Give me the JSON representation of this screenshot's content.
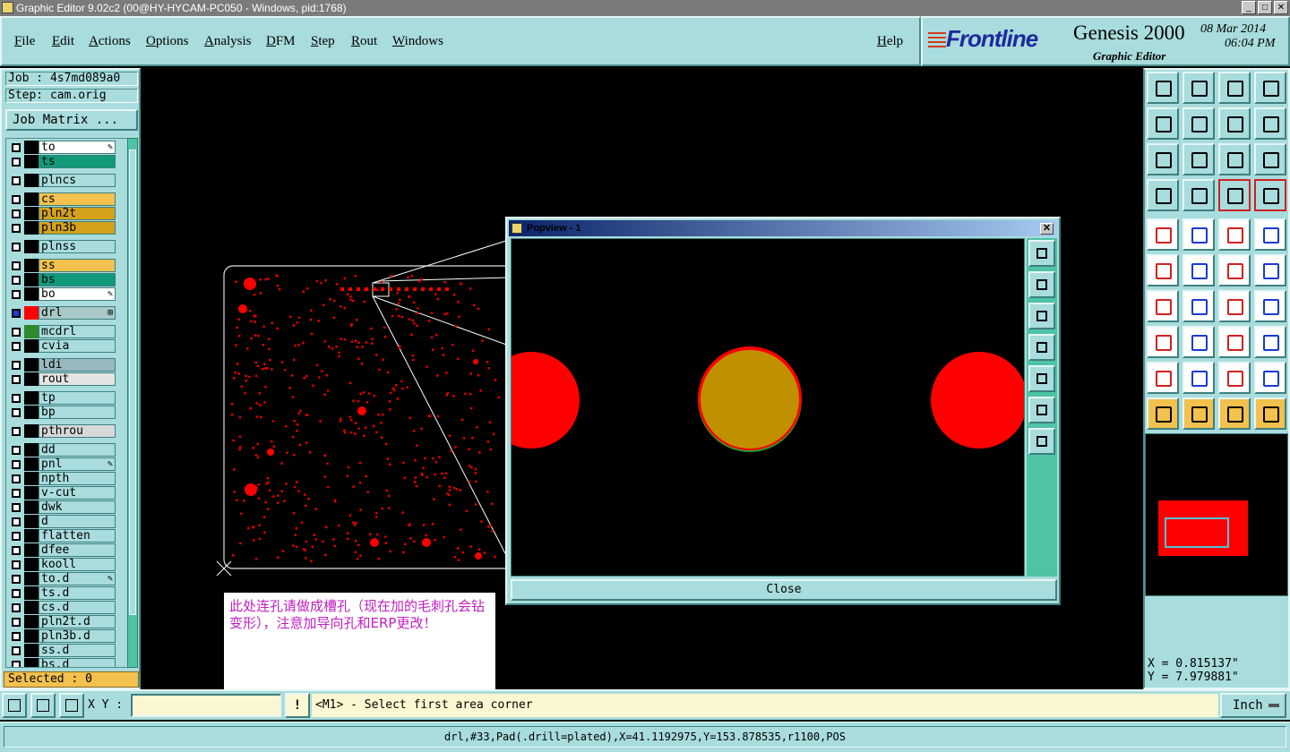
{
  "window": {
    "title": "Graphic Editor 9.02c2 (00@HY-HYCAM-PC050 - Windows, pid:1768)"
  },
  "menu": {
    "items": [
      "File",
      "Edit",
      "Actions",
      "Options",
      "Analysis",
      "DFM",
      "Step",
      "Rout",
      "Windows"
    ],
    "help": "Help"
  },
  "brand": {
    "logo": "Frontline",
    "product": "Genesis 2000",
    "subtitle": "Graphic Editor",
    "date": "08 Mar 2014",
    "time": "06:04 PM"
  },
  "job": {
    "job_label": "Job : 4s7md089a0",
    "step_label": "Step: cam.orig",
    "matrix_button": "Job Matrix ..."
  },
  "layers": [
    {
      "name": "to",
      "color": "#ffffff",
      "mark": "✎"
    },
    {
      "name": "ts",
      "color": "#109a7a",
      "mark": ""
    },
    {
      "name": "plncs",
      "color": "#a9dcdc",
      "mark": ""
    },
    {
      "name": "cs",
      "color": "#f2c14e",
      "mark": ""
    },
    {
      "name": "pln2t",
      "color": "#d4a21a",
      "mark": ""
    },
    {
      "name": "pln3b",
      "color": "#d4a21a",
      "mark": ""
    },
    {
      "name": "plnss",
      "color": "#a9dcdc",
      "mark": ""
    },
    {
      "name": "ss",
      "color": "#f2c14e",
      "mark": ""
    },
    {
      "name": "bs",
      "color": "#109a7a",
      "mark": ""
    },
    {
      "name": "bo",
      "color": "#ffffff",
      "mark": "✎"
    },
    {
      "name": "drl",
      "color": "#a9c8c8",
      "mark": "⊞"
    },
    {
      "name": "mcdrl",
      "color": "#a9dcdc",
      "mark": ""
    },
    {
      "name": "cvia",
      "color": "#a9dcdc",
      "mark": ""
    },
    {
      "name": "ldi",
      "color": "#9ab8c0",
      "mark": ""
    },
    {
      "name": "rout",
      "color": "#e4e4e4",
      "mark": ""
    },
    {
      "name": "tp",
      "color": "#a9dcdc",
      "mark": ""
    },
    {
      "name": "bp",
      "color": "#a9dcdc",
      "mark": ""
    },
    {
      "name": "pthrou",
      "color": "#d8d8d8",
      "mark": ""
    },
    {
      "name": "dd",
      "color": "#a9dcdc",
      "mark": ""
    },
    {
      "name": "pnl",
      "color": "#a9dcdc",
      "mark": "✎"
    },
    {
      "name": "npth",
      "color": "#a9dcdc",
      "mark": ""
    },
    {
      "name": "v-cut",
      "color": "#a9dcdc",
      "mark": ""
    },
    {
      "name": "dwk",
      "color": "#a9dcdc",
      "mark": ""
    },
    {
      "name": "d",
      "color": "#a9dcdc",
      "mark": ""
    },
    {
      "name": "flatten",
      "color": "#a9dcdc",
      "mark": ""
    },
    {
      "name": "dfee",
      "color": "#a9dcdc",
      "mark": ""
    },
    {
      "name": "kooll",
      "color": "#a9dcdc",
      "mark": ""
    },
    {
      "name": "to.d",
      "color": "#a9dcdc",
      "mark": "✎"
    },
    {
      "name": "ts.d",
      "color": "#a9dcdc",
      "mark": ""
    },
    {
      "name": "cs.d",
      "color": "#a9dcdc",
      "mark": ""
    },
    {
      "name": "pln2t.d",
      "color": "#a9dcdc",
      "mark": ""
    },
    {
      "name": "pln3b.d",
      "color": "#a9dcdc",
      "mark": ""
    },
    {
      "name": "ss.d",
      "color": "#a9dcdc",
      "mark": ""
    },
    {
      "name": "bs.d",
      "color": "#a9dcdc",
      "mark": ""
    }
  ],
  "selected": "Selected : 0",
  "popview": {
    "title": "Popview - 1",
    "close_label": "Close"
  },
  "note": {
    "text": "此处连孔请做成槽孔（现在加的毛刺孔会钻变形），注意加导向孔和ERP更改！"
  },
  "coords": {
    "x": "X = 0.815137\"",
    "y": "Y = 7.979881\""
  },
  "input_bar": {
    "xy_label": "X Y :",
    "xy_value": "",
    "bang": "!",
    "prompt": "<M1> - Select first area corner",
    "unit": "Inch"
  },
  "status": "drl,#33,Pad(.drill=plated),X=41.1192975,Y=153.878535,r1100,POS",
  "colors": {
    "panel": "#a9dcdc",
    "accent_green": "#4fc3a6",
    "feature_red": "#ff0000",
    "feature_olive": "#c09000"
  }
}
